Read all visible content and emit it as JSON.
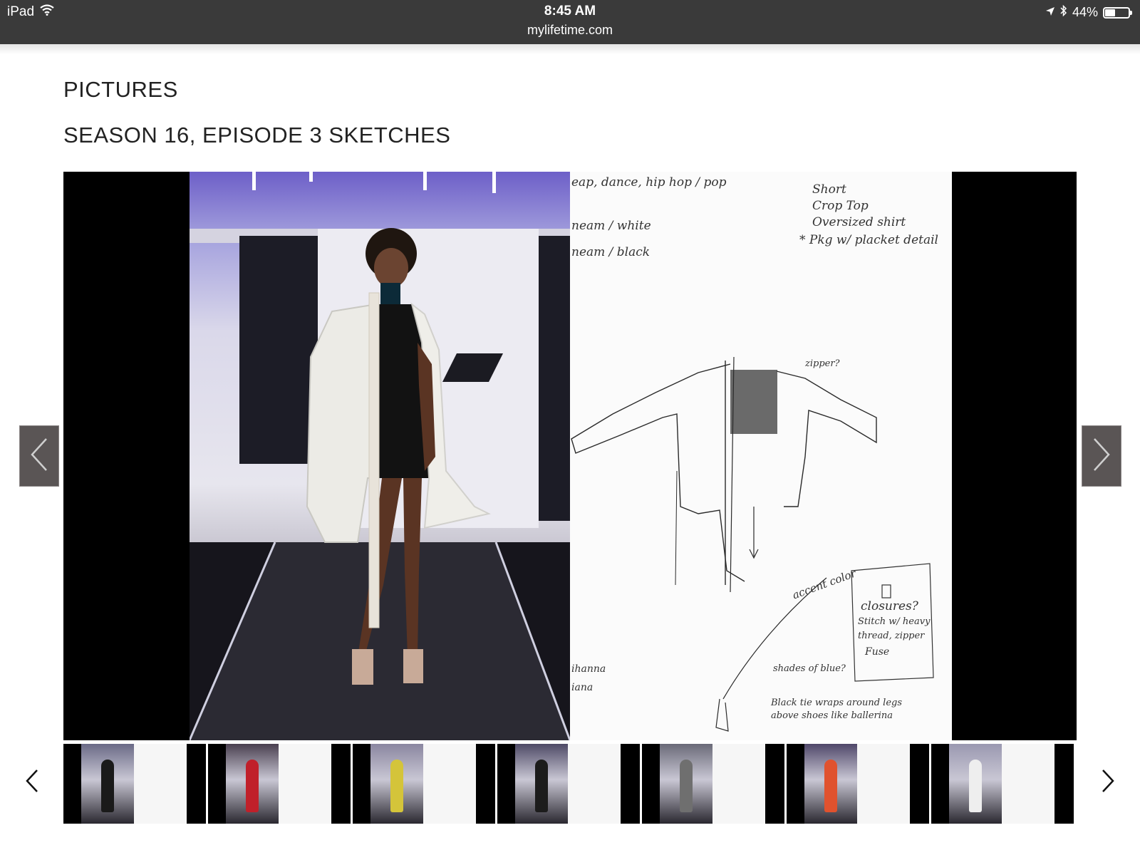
{
  "status_bar": {
    "device": "iPad",
    "time": "8:45 AM",
    "url": "mylifetime.com",
    "battery": "44%",
    "battery_level": 0.44
  },
  "page": {
    "section_title": "PICTURES",
    "gallery_title": "SEASON 16, EPISODE 3 SKETCHES"
  },
  "slide": {
    "sketch_notes": [
      "eap, dance, hip hop / pop",
      "Short",
      "Crop Top",
      "Oversized shirt",
      "* Pkg w/ placket detail",
      "neam / white",
      "neam / black",
      "zipper?",
      "accent color",
      "closures?",
      "Stitch w/ heavy",
      "thread, zipper",
      "Fuse",
      "shades of blue?",
      "Black tie wraps around legs",
      "above shoes like ballerina",
      "ihanna",
      "iana"
    ]
  },
  "thumbnails": [
    {
      "bg": "#6a6a86",
      "outfit": "#1a1a1a",
      "active": true
    },
    {
      "bg": "#4a4050",
      "outfit": "#c0202a",
      "active": false
    },
    {
      "bg": "#8a86a0",
      "outfit": "#d4c43a",
      "active": false
    },
    {
      "bg": "#4e4a66",
      "outfit": "#1c1c1c",
      "active": false
    },
    {
      "bg": "#6a6a78",
      "outfit": "#6f6f6f",
      "active": false
    },
    {
      "bg": "#50486a",
      "outfit": "#e0522e",
      "active": false
    },
    {
      "bg": "#9a98b0",
      "outfit": "#eeeeee",
      "active": false
    }
  ],
  "colors": {
    "status_bar": "#3a3a3a",
    "nav_button": "#5a5555"
  },
  "icons": {
    "wifi": "wifi-icon",
    "location": "location-arrow-icon",
    "bluetooth": "bluetooth-icon",
    "battery": "battery-icon",
    "prev": "chevron-left-icon",
    "next": "chevron-right-icon"
  }
}
